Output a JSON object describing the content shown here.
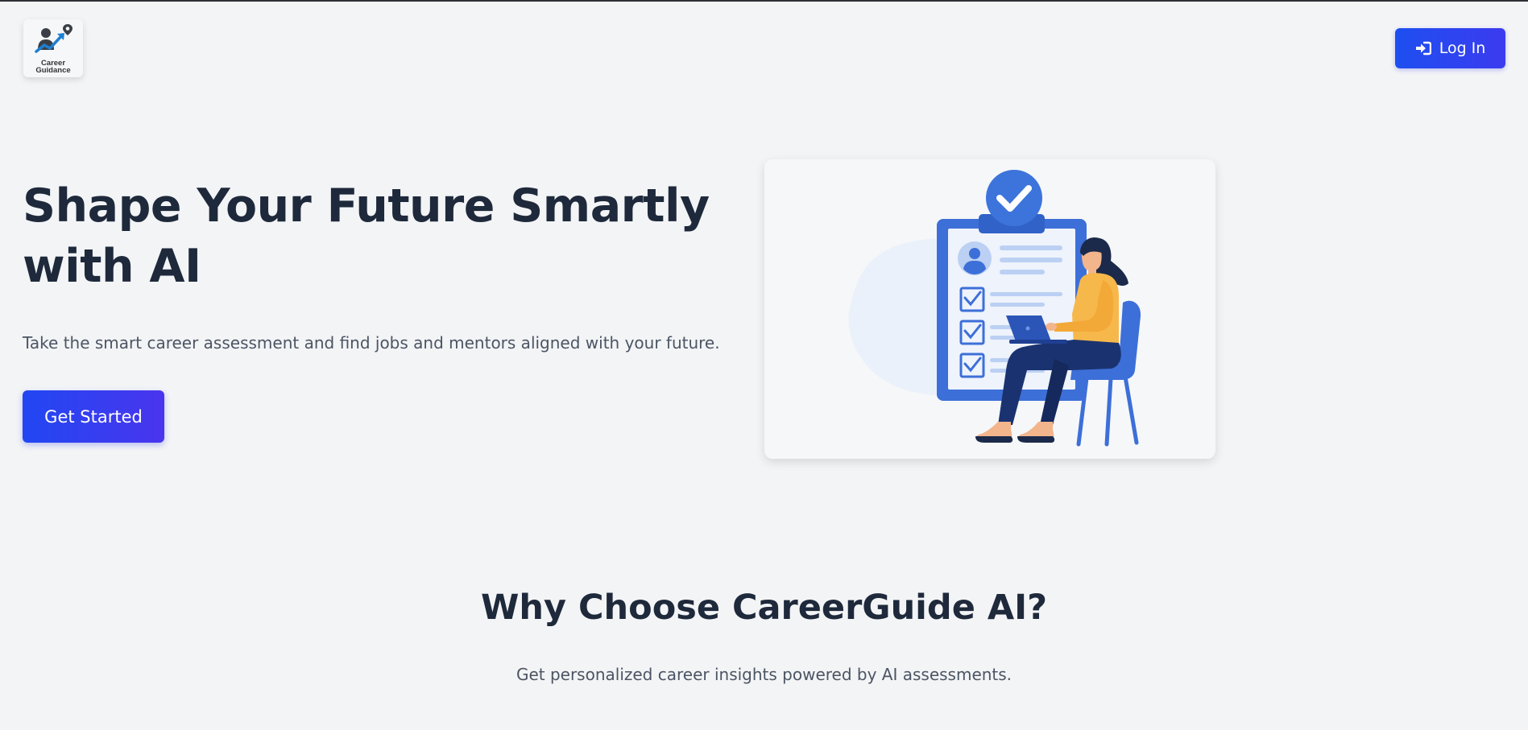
{
  "header": {
    "logo_text_line1": "Career",
    "logo_text_line2": "Guidance",
    "login_label": "Log In"
  },
  "hero": {
    "title": "Shape Your Future Smartly with AI",
    "subtitle": "Take the smart career assessment and find jobs and mentors aligned with your future.",
    "cta_label": "Get Started"
  },
  "why": {
    "title": "Why Choose CareerGuide AI?",
    "subtitle": "Get personalized career insights powered by AI assessments."
  },
  "colors": {
    "primary": "#1d4ff0",
    "primary_end": "#4a35ee",
    "heading": "#1e293b",
    "body_text": "#4b5563",
    "background": "#f3f4f6",
    "illustration_blue": "#3d6fd8",
    "illustration_yellow": "#f7b84b"
  },
  "icons": {
    "logo": "career-guidance-logo-icon",
    "login": "sign-in-icon",
    "illustration": "checklist-woman-laptop-illustration"
  }
}
